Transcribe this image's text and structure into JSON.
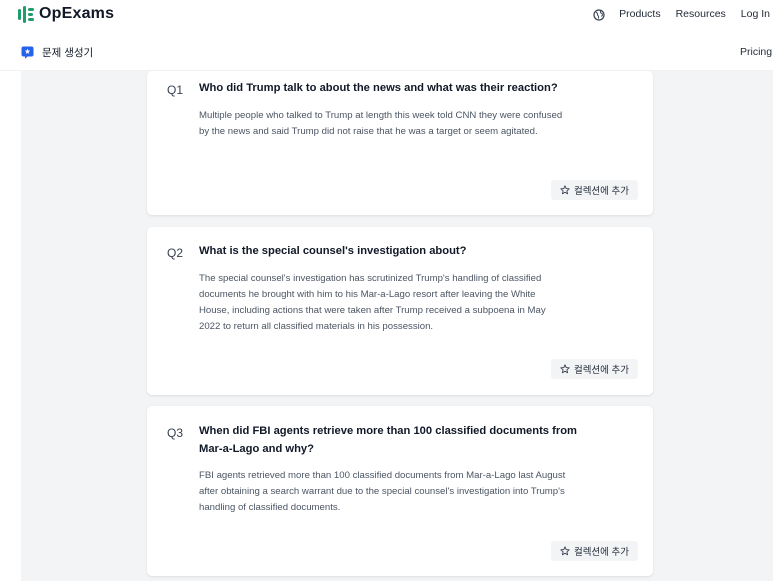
{
  "header": {
    "brand": "OpExams",
    "nav": [
      "Products",
      "Resources",
      "Log In"
    ]
  },
  "subheader": {
    "app_title": "문제 생성기",
    "pricing": "Pricing"
  },
  "questions": [
    {
      "number": "Q1",
      "question": "Who did Trump talk to about the news and what was their reaction?",
      "answer": "Multiple people who talked to Trump at length this week told CNN they were confused by the news and said Trump did not raise that he was a target or seem agitated.",
      "button": "컬렉션에 추가"
    },
    {
      "number": "Q2",
      "question": "What is the special counsel's investigation about?",
      "answer": "The special counsel's investigation has scrutinized Trump's handling of classified documents he brought with him to his Mar-a-Lago resort after leaving the White House, including actions that were taken after Trump received a subpoena in May 2022 to return all classified materials in his possession.",
      "button": "컬렉션에 추가"
    },
    {
      "number": "Q3",
      "question": "When did FBI agents retrieve more than 100 classified documents from Mar-a-Lago and why?",
      "answer": "FBI agents retrieved more than 100 classified documents from Mar-a-Lago last August after obtaining a search warrant due to the special counsel's investigation into Trump's handling of classified documents.",
      "button": "컬렉션에 추가"
    }
  ],
  "colors": {
    "brand": "#1f9d6b",
    "app_icon": "#2563eb",
    "content_background": "#f3f4f6",
    "button_background": "#f3f4f6"
  },
  "icons": [
    "logo-icon",
    "globe-icon",
    "app-icon",
    "star-icon"
  ]
}
